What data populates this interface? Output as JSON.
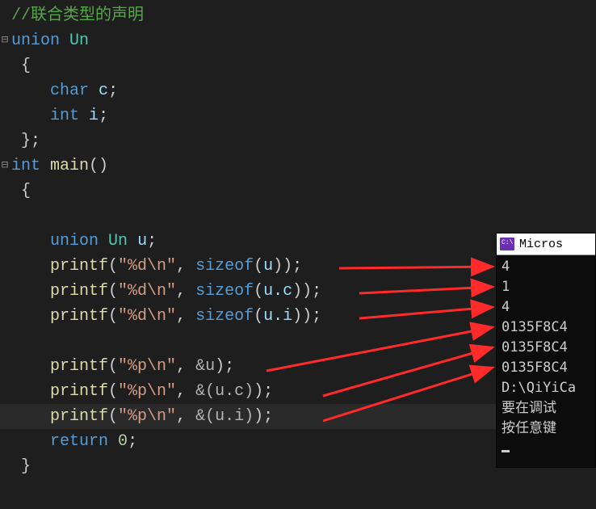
{
  "code": {
    "l1": "//联合类型的声明",
    "l2": {
      "kw": "union",
      "name": "Un"
    },
    "l3": "{",
    "l4": {
      "type": "char",
      "var": "c"
    },
    "l5": {
      "type": "int",
      "var": "i"
    },
    "l6": "};",
    "l7": {
      "type": "int",
      "func": "main",
      "args": "()"
    },
    "l8": "{",
    "l9": {
      "kw": "union",
      "cls": "Un",
      "var": "u"
    },
    "l10": {
      "func": "printf",
      "str": "\"%d\\n\"",
      "builtin": "sizeof",
      "arg": "u"
    },
    "l11": {
      "func": "printf",
      "str": "\"%d\\n\"",
      "builtin": "sizeof",
      "arg": "u.c"
    },
    "l12": {
      "func": "printf",
      "str": "\"%d\\n\"",
      "builtin": "sizeof",
      "arg": "u.i"
    },
    "l14": {
      "func": "printf",
      "str": "\"%p\\n\"",
      "amp": "&u"
    },
    "l15": {
      "func": "printf",
      "str": "\"%p\\n\"",
      "amp": "&(u.c)"
    },
    "l16": {
      "func": "printf",
      "str": "\"%p\\n\"",
      "amp": "&(u.i)"
    },
    "l17": {
      "kw": "return",
      "val": "0"
    },
    "l18": "}"
  },
  "console": {
    "title": "Micros",
    "lines": [
      "4",
      "1",
      "4",
      "0135F8C4",
      "0135F8C4",
      "0135F8C4",
      "",
      "D:\\QiYiCa",
      "要在调试",
      "按任意键"
    ]
  }
}
